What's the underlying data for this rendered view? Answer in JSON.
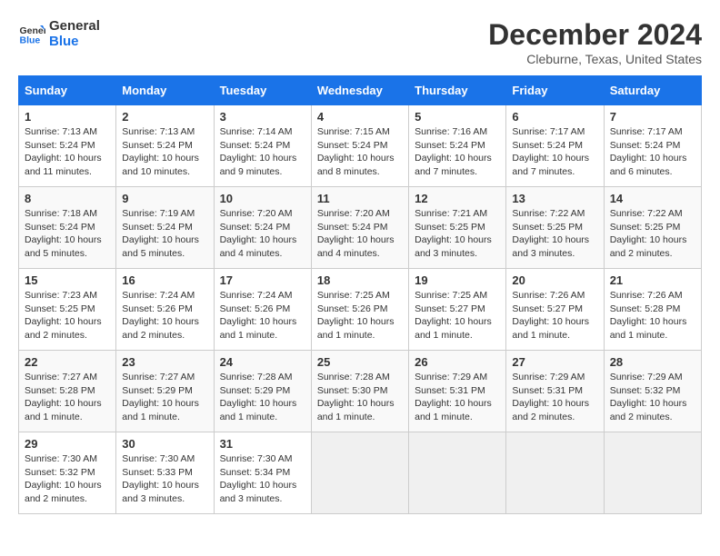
{
  "logo": {
    "line1": "General",
    "line2": "Blue"
  },
  "title": "December 2024",
  "subtitle": "Cleburne, Texas, United States",
  "days_header": [
    "Sunday",
    "Monday",
    "Tuesday",
    "Wednesday",
    "Thursday",
    "Friday",
    "Saturday"
  ],
  "weeks": [
    [
      {
        "num": "1",
        "info": "Sunrise: 7:13 AM\nSunset: 5:24 PM\nDaylight: 10 hours\nand 11 minutes."
      },
      {
        "num": "2",
        "info": "Sunrise: 7:13 AM\nSunset: 5:24 PM\nDaylight: 10 hours\nand 10 minutes."
      },
      {
        "num": "3",
        "info": "Sunrise: 7:14 AM\nSunset: 5:24 PM\nDaylight: 10 hours\nand 9 minutes."
      },
      {
        "num": "4",
        "info": "Sunrise: 7:15 AM\nSunset: 5:24 PM\nDaylight: 10 hours\nand 8 minutes."
      },
      {
        "num": "5",
        "info": "Sunrise: 7:16 AM\nSunset: 5:24 PM\nDaylight: 10 hours\nand 7 minutes."
      },
      {
        "num": "6",
        "info": "Sunrise: 7:17 AM\nSunset: 5:24 PM\nDaylight: 10 hours\nand 7 minutes."
      },
      {
        "num": "7",
        "info": "Sunrise: 7:17 AM\nSunset: 5:24 PM\nDaylight: 10 hours\nand 6 minutes."
      }
    ],
    [
      {
        "num": "8",
        "info": "Sunrise: 7:18 AM\nSunset: 5:24 PM\nDaylight: 10 hours\nand 5 minutes."
      },
      {
        "num": "9",
        "info": "Sunrise: 7:19 AM\nSunset: 5:24 PM\nDaylight: 10 hours\nand 5 minutes."
      },
      {
        "num": "10",
        "info": "Sunrise: 7:20 AM\nSunset: 5:24 PM\nDaylight: 10 hours\nand 4 minutes."
      },
      {
        "num": "11",
        "info": "Sunrise: 7:20 AM\nSunset: 5:24 PM\nDaylight: 10 hours\nand 4 minutes."
      },
      {
        "num": "12",
        "info": "Sunrise: 7:21 AM\nSunset: 5:25 PM\nDaylight: 10 hours\nand 3 minutes."
      },
      {
        "num": "13",
        "info": "Sunrise: 7:22 AM\nSunset: 5:25 PM\nDaylight: 10 hours\nand 3 minutes."
      },
      {
        "num": "14",
        "info": "Sunrise: 7:22 AM\nSunset: 5:25 PM\nDaylight: 10 hours\nand 2 minutes."
      }
    ],
    [
      {
        "num": "15",
        "info": "Sunrise: 7:23 AM\nSunset: 5:25 PM\nDaylight: 10 hours\nand 2 minutes."
      },
      {
        "num": "16",
        "info": "Sunrise: 7:24 AM\nSunset: 5:26 PM\nDaylight: 10 hours\nand 2 minutes."
      },
      {
        "num": "17",
        "info": "Sunrise: 7:24 AM\nSunset: 5:26 PM\nDaylight: 10 hours\nand 1 minute."
      },
      {
        "num": "18",
        "info": "Sunrise: 7:25 AM\nSunset: 5:26 PM\nDaylight: 10 hours\nand 1 minute."
      },
      {
        "num": "19",
        "info": "Sunrise: 7:25 AM\nSunset: 5:27 PM\nDaylight: 10 hours\nand 1 minute."
      },
      {
        "num": "20",
        "info": "Sunrise: 7:26 AM\nSunset: 5:27 PM\nDaylight: 10 hours\nand 1 minute."
      },
      {
        "num": "21",
        "info": "Sunrise: 7:26 AM\nSunset: 5:28 PM\nDaylight: 10 hours\nand 1 minute."
      }
    ],
    [
      {
        "num": "22",
        "info": "Sunrise: 7:27 AM\nSunset: 5:28 PM\nDaylight: 10 hours\nand 1 minute."
      },
      {
        "num": "23",
        "info": "Sunrise: 7:27 AM\nSunset: 5:29 PM\nDaylight: 10 hours\nand 1 minute."
      },
      {
        "num": "24",
        "info": "Sunrise: 7:28 AM\nSunset: 5:29 PM\nDaylight: 10 hours\nand 1 minute."
      },
      {
        "num": "25",
        "info": "Sunrise: 7:28 AM\nSunset: 5:30 PM\nDaylight: 10 hours\nand 1 minute."
      },
      {
        "num": "26",
        "info": "Sunrise: 7:29 AM\nSunset: 5:31 PM\nDaylight: 10 hours\nand 1 minute."
      },
      {
        "num": "27",
        "info": "Sunrise: 7:29 AM\nSunset: 5:31 PM\nDaylight: 10 hours\nand 2 minutes."
      },
      {
        "num": "28",
        "info": "Sunrise: 7:29 AM\nSunset: 5:32 PM\nDaylight: 10 hours\nand 2 minutes."
      }
    ],
    [
      {
        "num": "29",
        "info": "Sunrise: 7:30 AM\nSunset: 5:32 PM\nDaylight: 10 hours\nand 2 minutes."
      },
      {
        "num": "30",
        "info": "Sunrise: 7:30 AM\nSunset: 5:33 PM\nDaylight: 10 hours\nand 3 minutes."
      },
      {
        "num": "31",
        "info": "Sunrise: 7:30 AM\nSunset: 5:34 PM\nDaylight: 10 hours\nand 3 minutes."
      },
      {
        "num": "",
        "info": ""
      },
      {
        "num": "",
        "info": ""
      },
      {
        "num": "",
        "info": ""
      },
      {
        "num": "",
        "info": ""
      }
    ]
  ]
}
